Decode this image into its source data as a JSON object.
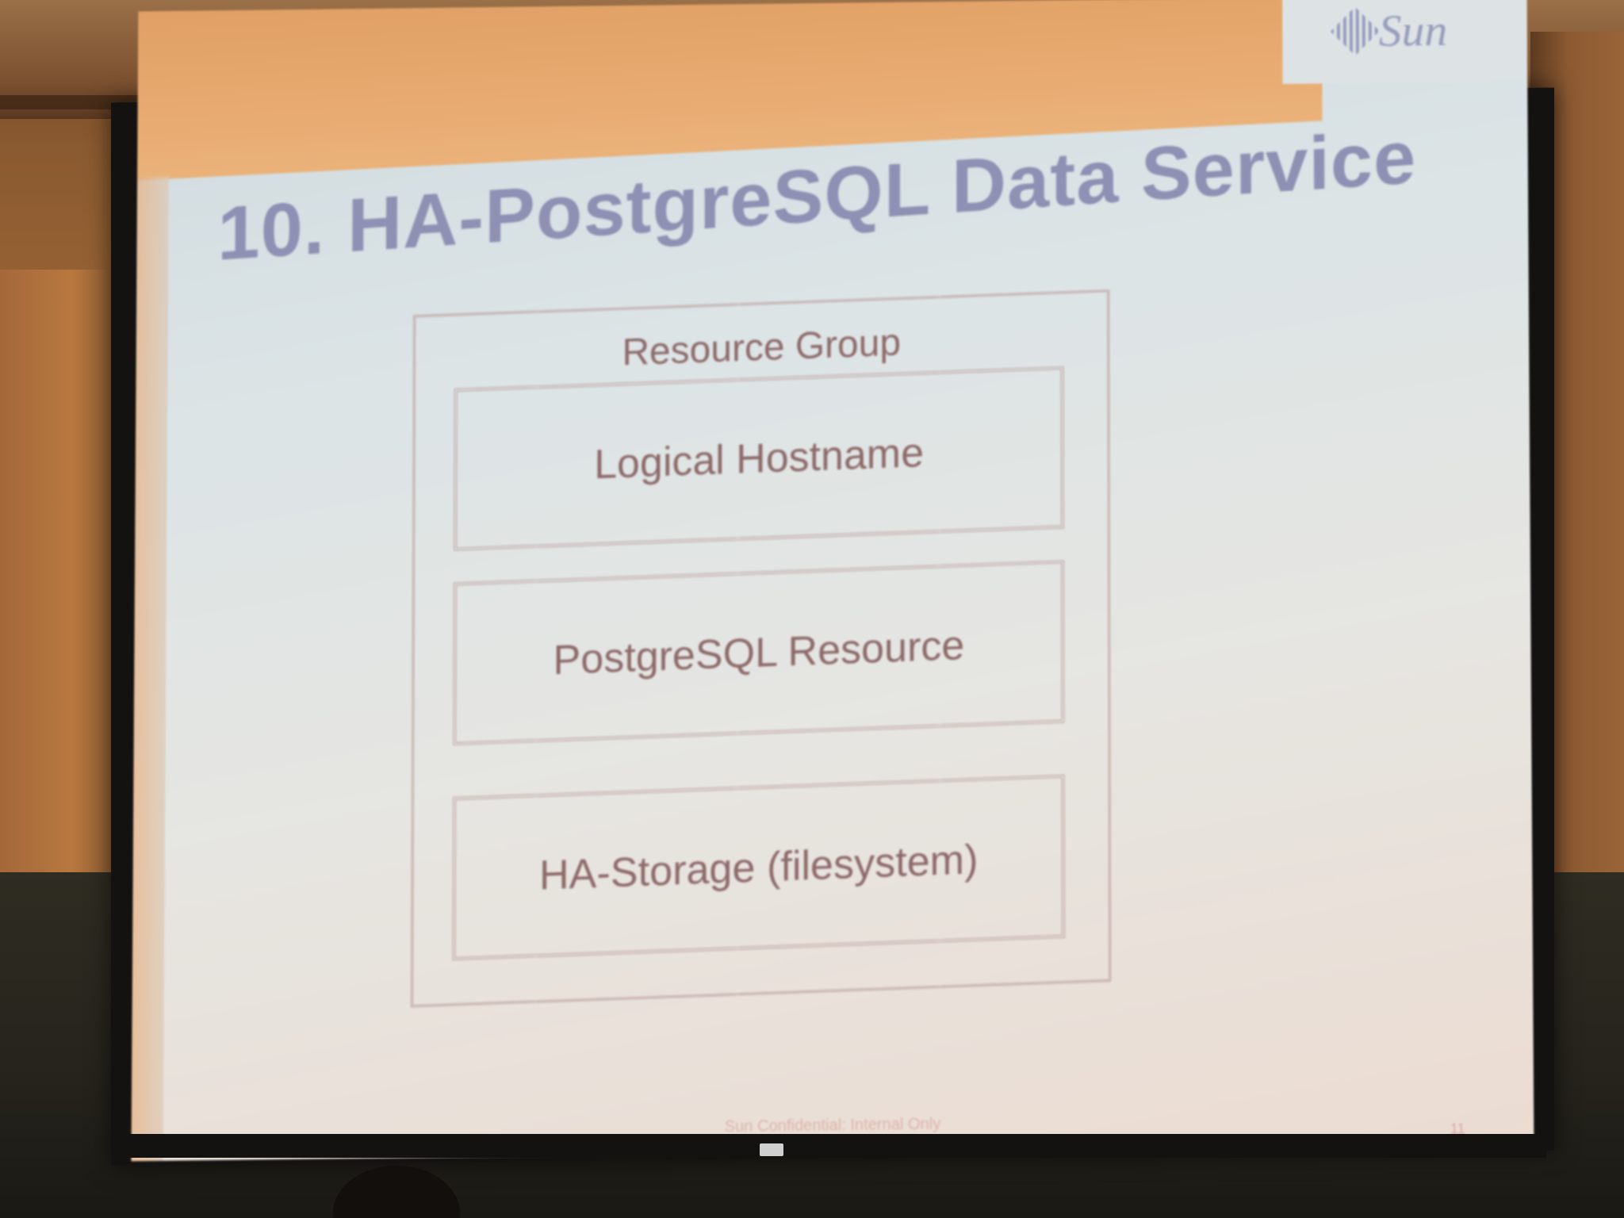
{
  "slide": {
    "logo_text": "Sun",
    "title": "10. HA-PostgreSQL Data Service",
    "group_label": "Resource Group",
    "resources": [
      "Logical Hostname",
      "PostgreSQL Resource",
      "HA-Storage (filesystem)"
    ],
    "footer": "Sun Confidential: Internal Only",
    "page_number": "11"
  },
  "colors": {
    "title": "#8e90b4",
    "diagram_text": "#8e6a6a",
    "accent_stripe": "#e0a066"
  }
}
